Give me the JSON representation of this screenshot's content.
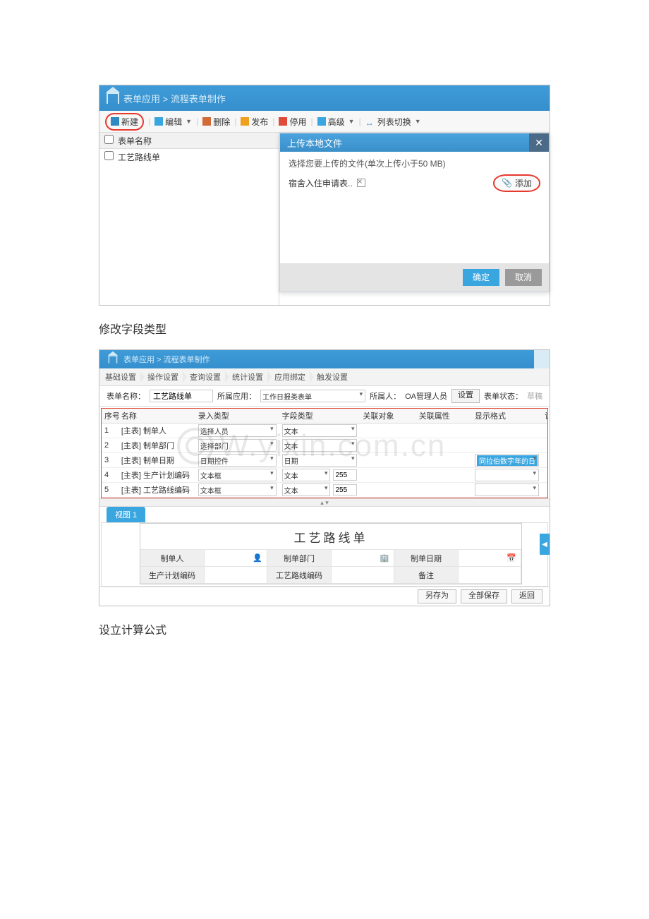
{
  "s1": {
    "breadcrumb": "表单应用 > 流程表单制作",
    "toolbar": {
      "new": "新建",
      "edit": "编辑",
      "del": "删除",
      "save": "发布",
      "stop": "停用",
      "adv": "高级",
      "swap": "列表切换"
    },
    "list": {
      "header": "表单名称",
      "row1": "工艺路线单"
    },
    "dialog": {
      "title": "上传本地文件",
      "tip": "选择您要上传的文件(单次上传小于50 MB)",
      "filename": "宿舍入住申请表..",
      "add": "添加",
      "ok": "确定",
      "cancel": "取消"
    }
  },
  "caption1": "修改字段类型",
  "s2": {
    "breadcrumb": "表单应用 > 流程表单制作",
    "tabs": [
      "基础设置",
      "操作设置",
      "查询设置",
      "统计设置",
      "应用绑定",
      "触发设置"
    ],
    "meta": {
      "name_lbl": "表单名称：",
      "name_val": "工艺路线单",
      "app_lbl": "所属应用：",
      "app_val": "工作日报类表单",
      "owner_lbl": "所属人：",
      "owner_val": "OA管理人员",
      "set_btn": "设置",
      "state_lbl": "表单状态：",
      "state_val": "草稿"
    },
    "grid": {
      "headers": {
        "seq": "序号",
        "name": "名称",
        "input_type": "录入类型",
        "field_type": "字段类型",
        "rel_obj": "关联对象",
        "rel_prop": "关联属性",
        "disp_fmt": "显示格式",
        "formula": "计算公式"
      },
      "rows": [
        {
          "seq": "1",
          "name": "[主表] 制单人",
          "it": "选择人员",
          "ft": "文本",
          "hl": ""
        },
        {
          "seq": "2",
          "name": "[主表] 制单部门",
          "it": "选择部门",
          "ft": "文本",
          "hl": ""
        },
        {
          "seq": "3",
          "name": "[主表] 制单日期",
          "it": "日期控件",
          "ft": "日期",
          "hl": "同拉伯数字年的日"
        },
        {
          "seq": "4",
          "name": "[主表] 生产计划编码",
          "it": "文本框",
          "ft": "文本",
          "len": "255",
          "hl": ""
        },
        {
          "seq": "5",
          "name": "[主表] 工艺路线编码",
          "it": "文本框",
          "ft": "文本",
          "len": "255",
          "hl": ""
        }
      ]
    },
    "splitter_glyphs": "▴    ▾",
    "view_tab": "视图 1",
    "preview": {
      "title": "工艺路线单",
      "labels": {
        "r1c1": "制单人",
        "r1c2": "制单部门",
        "r1c3": "制单日期",
        "r2c1": "生产计划编码",
        "r2c2": "工艺路线编码",
        "r2c3": "备注"
      }
    },
    "foot": {
      "saveas": "另存为",
      "saveall": "全部保存",
      "back": "返回"
    },
    "watermark": "W.yixin.com.cn"
  },
  "caption2": "设立计算公式"
}
